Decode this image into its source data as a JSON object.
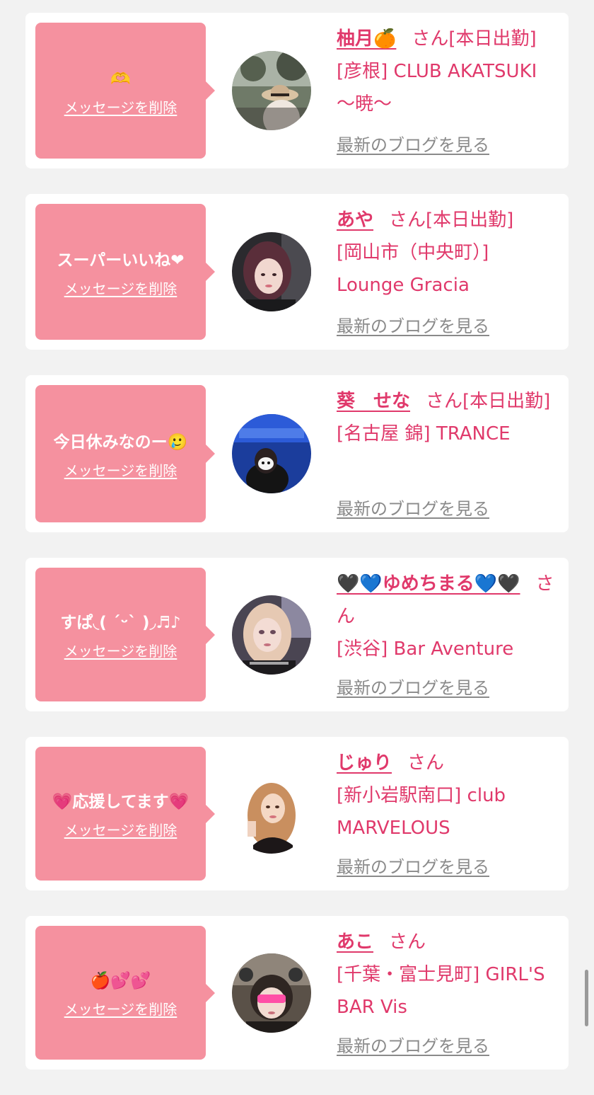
{
  "delete_label": "メッセージを削除",
  "blog_label": "最新のブログを見る",
  "san_label": "さん",
  "cards": [
    {
      "message": "🫶",
      "name": "柚月🍊",
      "suffix": "さん[本日出勤]",
      "shop": "[彦根] CLUB AKATSUKI 〜暁〜"
    },
    {
      "message": "スーパーいいね❤",
      "name": "あや",
      "suffix": "さん[本日出勤]",
      "shop": "[岡山市（中央町）] Lounge Gracia"
    },
    {
      "message": "今日休みなのー🥲",
      "name": "葵　せな",
      "suffix": "さん[本日出勤]",
      "shop": "[名古屋 錦] TRANCE"
    },
    {
      "message": "すぱ◟( ˊᵕˋ )◞♬♪",
      "name": "🖤💙ゆめちまる💙🖤",
      "suffix": "さん",
      "shop": "[渋谷] Bar Aventure"
    },
    {
      "message": "💗応援してます💗",
      "name": "じゅり",
      "suffix": "さん",
      "shop": "[新小岩駅南口] club MARVELOUS"
    },
    {
      "message": "🍎💕💕",
      "name": "あこ",
      "suffix": "さん",
      "shop": "[千葉・富士見町] GIRL'S BAR Vis"
    }
  ]
}
